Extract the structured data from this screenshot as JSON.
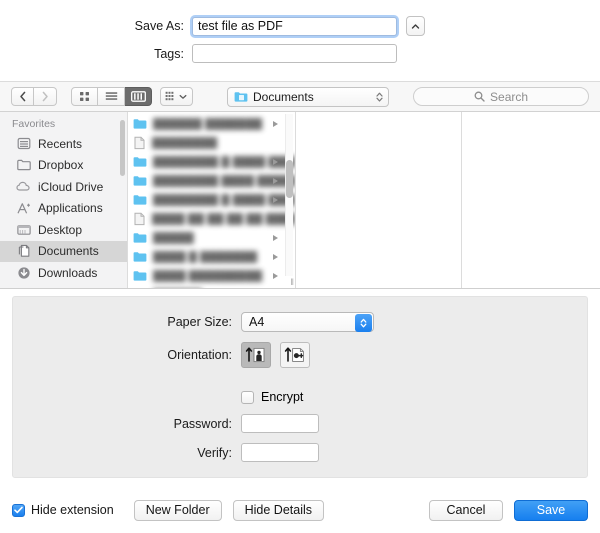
{
  "dialog": {
    "save_as_label": "Save As:",
    "save_as_value": "test file as PDF",
    "tags_label": "Tags:",
    "tags_value": "",
    "tags_placeholder": "",
    "disclosure_icon": "chevron-up-icon"
  },
  "toolbar": {
    "back_icon": "chevron-left-icon",
    "forward_icon": "chevron-right-icon",
    "view_icon_grid": "icon-view-icon",
    "view_list": "list-view-icon",
    "view_column": "column-view-icon",
    "arrange_icon": "arrange-by-icon",
    "arrange_chevron": "chevron-down-icon",
    "path_icon": "folder-blue-icon",
    "path_label": "Documents",
    "path_stepper_icon": "up-down-arrows-icon",
    "search_icon": "search-icon",
    "search_placeholder": "Search",
    "search_value": ""
  },
  "sidebar": {
    "header": "Favorites",
    "items": [
      {
        "label": "Recents",
        "icon": "recents-icon",
        "selected": false
      },
      {
        "label": "Dropbox",
        "icon": "folder-icon",
        "selected": false
      },
      {
        "label": "iCloud Drive",
        "icon": "cloud-icon",
        "selected": false
      },
      {
        "label": "Applications",
        "icon": "applications-icon",
        "selected": false
      },
      {
        "label": "Desktop",
        "icon": "desktop-icon",
        "selected": false
      },
      {
        "label": "Documents",
        "icon": "documents-icon",
        "selected": true
      },
      {
        "label": "Downloads",
        "icon": "downloads-icon",
        "selected": false
      }
    ]
  },
  "browser": {
    "column_files": [
      {
        "name": "██████ ███████",
        "icon": "folder-blue-icon",
        "has_arrow": true
      },
      {
        "name": "████████",
        "icon": "document-icon",
        "has_arrow": false
      },
      {
        "name": "████████  █ ████ ████",
        "icon": "folder-blue-icon",
        "has_arrow": true
      },
      {
        "name": "████████ ████ ██████",
        "icon": "folder-blue-icon",
        "has_arrow": true
      },
      {
        "name": "████████  █ ████ ████",
        "icon": "folder-blue-icon",
        "has_arrow": true
      },
      {
        "name": "████ ██ ██   ██ ██ ████",
        "icon": "document-icon",
        "has_arrow": false
      },
      {
        "name": "█████",
        "icon": "folder-blue-icon",
        "has_arrow": true
      },
      {
        "name": "████ █ ███████",
        "icon": "folder-blue-icon",
        "has_arrow": true
      },
      {
        "name": "████ █████████",
        "icon": "folder-blue-icon",
        "has_arrow": true
      },
      {
        "name": "██████",
        "icon": "folder-blue-icon",
        "has_arrow": true
      },
      {
        "name": "█████████",
        "icon": "folder-blue-icon",
        "has_arrow": true
      }
    ],
    "scrollbar_icon": "vertical-scrollbar",
    "resize_grip": "‖"
  },
  "options": {
    "paper_size_label": "Paper Size:",
    "paper_size_value": "A4",
    "orientation_label": "Orientation:",
    "orientation_portrait_icon": "portrait-orientation-icon",
    "orientation_landscape_icon": "landscape-orientation-icon",
    "orientation_selected": "portrait",
    "encrypt_label": "Encrypt",
    "encrypt_checked": false,
    "password_label": "Password:",
    "password_value": "",
    "verify_label": "Verify:",
    "verify_value": ""
  },
  "footer": {
    "hide_extension_label": "Hide extension",
    "hide_extension_checked": true,
    "new_folder_label": "New Folder",
    "hide_details_label": "Hide Details",
    "cancel_label": "Cancel",
    "save_label": "Save"
  },
  "colors": {
    "accent_blue": "#167fef",
    "folder_blue": "#5ec2f0",
    "selection_gray": "#d6d6d6",
    "panel_gray": "#ececec"
  }
}
